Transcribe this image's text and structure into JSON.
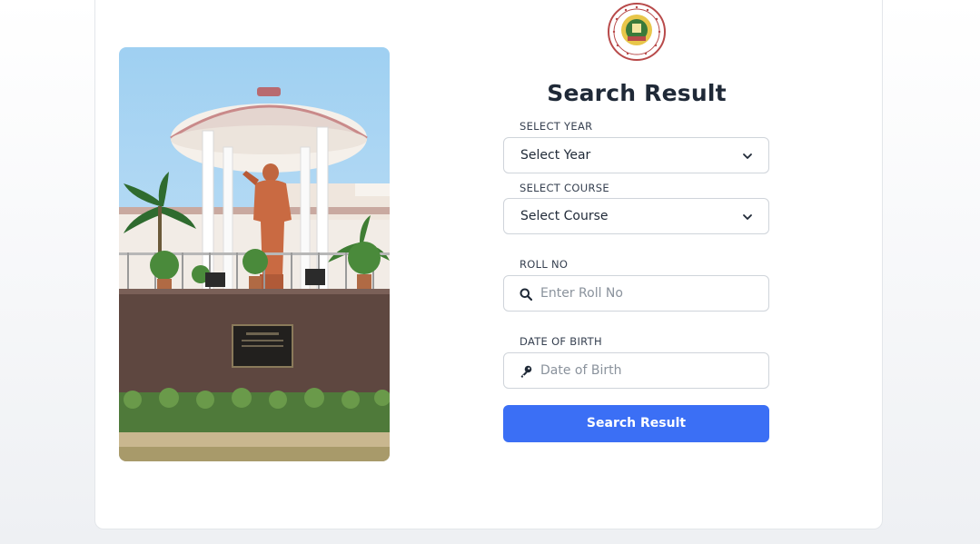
{
  "form": {
    "title": "Search Result",
    "year_label": "SELECT YEAR",
    "year_value": "Select Year",
    "course_label": "SELECT COURSE",
    "course_value": "Select Course",
    "roll_label": "ROLL NO",
    "roll_placeholder": "Enter Roll No",
    "dob_label": "DATE OF BIRTH",
    "dob_placeholder": "Date of Birth",
    "submit_label": "Search Result"
  },
  "icons": {
    "year_dropdown": "chevron-down-icon",
    "course_dropdown": "chevron-down-icon",
    "roll": "search-icon",
    "dob": "key-icon"
  },
  "colors": {
    "primary_button": "#3b6ff5",
    "title_text": "#1f2937"
  }
}
